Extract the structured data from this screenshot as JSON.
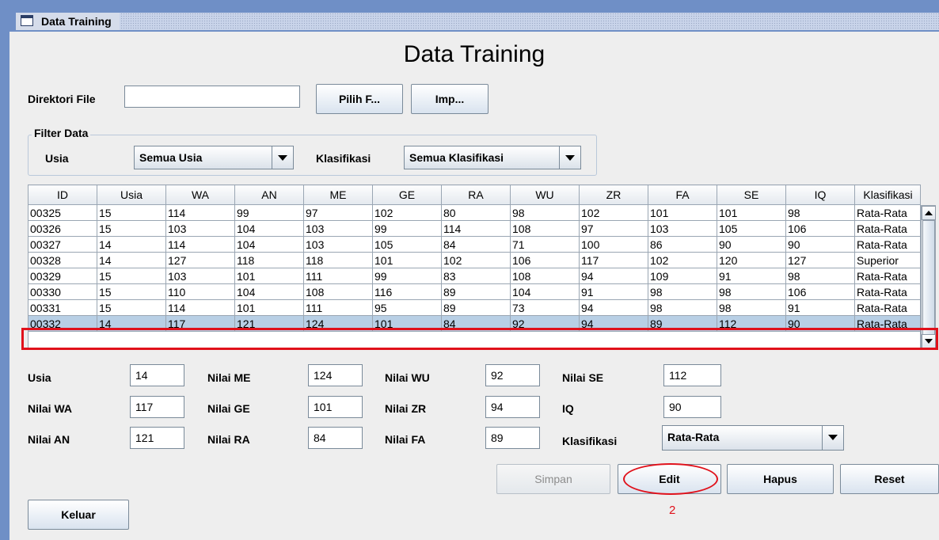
{
  "window": {
    "title": "Data Training"
  },
  "page_title": "Data Training",
  "file": {
    "label": "Direktori File",
    "value": "",
    "pick_label": "Pilih F...",
    "import_label": "Imp..."
  },
  "filter": {
    "group_title": "Filter Data",
    "usia_label": "Usia",
    "usia_value": "Semua Usia",
    "klasifikasi_label": "Klasifikasi",
    "klasifikasi_value": "Semua Klasifikasi"
  },
  "table": {
    "columns": [
      "ID",
      "Usia",
      "WA",
      "AN",
      "ME",
      "GE",
      "RA",
      "WU",
      "ZR",
      "FA",
      "SE",
      "IQ",
      "Klasifikasi"
    ],
    "rows": [
      [
        "00325",
        "15",
        "114",
        "99",
        "97",
        "102",
        "80",
        "98",
        "102",
        "101",
        "101",
        "98",
        "Rata-Rata"
      ],
      [
        "00326",
        "15",
        "103",
        "104",
        "103",
        "99",
        "114",
        "108",
        "97",
        "103",
        "105",
        "106",
        "Rata-Rata"
      ],
      [
        "00327",
        "14",
        "114",
        "104",
        "103",
        "105",
        "84",
        "71",
        "100",
        "86",
        "90",
        "90",
        "Rata-Rata"
      ],
      [
        "00328",
        "14",
        "127",
        "118",
        "118",
        "101",
        "102",
        "106",
        "117",
        "102",
        "120",
        "127",
        "Superior"
      ],
      [
        "00329",
        "15",
        "103",
        "101",
        "111",
        "99",
        "83",
        "108",
        "94",
        "109",
        "91",
        "98",
        "Rata-Rata"
      ],
      [
        "00330",
        "15",
        "110",
        "104",
        "108",
        "116",
        "89",
        "104",
        "91",
        "98",
        "98",
        "106",
        "Rata-Rata"
      ],
      [
        "00331",
        "15",
        "114",
        "101",
        "111",
        "95",
        "89",
        "73",
        "94",
        "98",
        "98",
        "91",
        "Rata-Rata"
      ],
      [
        "00332",
        "14",
        "117",
        "121",
        "124",
        "101",
        "84",
        "92",
        "94",
        "89",
        "112",
        "90",
        "Rata-Rata"
      ]
    ],
    "selected_row": 7
  },
  "form": {
    "usia": {
      "label": "Usia",
      "value": "14"
    },
    "wa": {
      "label": "Nilai WA",
      "value": "117"
    },
    "an": {
      "label": "Nilai AN",
      "value": "121"
    },
    "me": {
      "label": "Nilai ME",
      "value": "124"
    },
    "ge": {
      "label": "Nilai GE",
      "value": "101"
    },
    "ra": {
      "label": "Nilai RA",
      "value": "84"
    },
    "wu": {
      "label": "Nilai WU",
      "value": "92"
    },
    "zr": {
      "label": "Nilai ZR",
      "value": "94"
    },
    "fa": {
      "label": "Nilai FA",
      "value": "89"
    },
    "se": {
      "label": "Nilai SE",
      "value": "112"
    },
    "iq": {
      "label": "IQ",
      "value": "90"
    },
    "klasifikasi": {
      "label": "Klasifikasi",
      "value": "Rata-Rata"
    }
  },
  "buttons": {
    "simpan": "Simpan",
    "edit": "Edit",
    "hapus": "Hapus",
    "reset": "Reset",
    "keluar": "Keluar"
  },
  "annotation": {
    "step": "2",
    "color": "#e0111b"
  },
  "colors": {
    "frame": "#6f8fc6",
    "selection": "#b8cfe5",
    "background": "#eeeeee"
  }
}
